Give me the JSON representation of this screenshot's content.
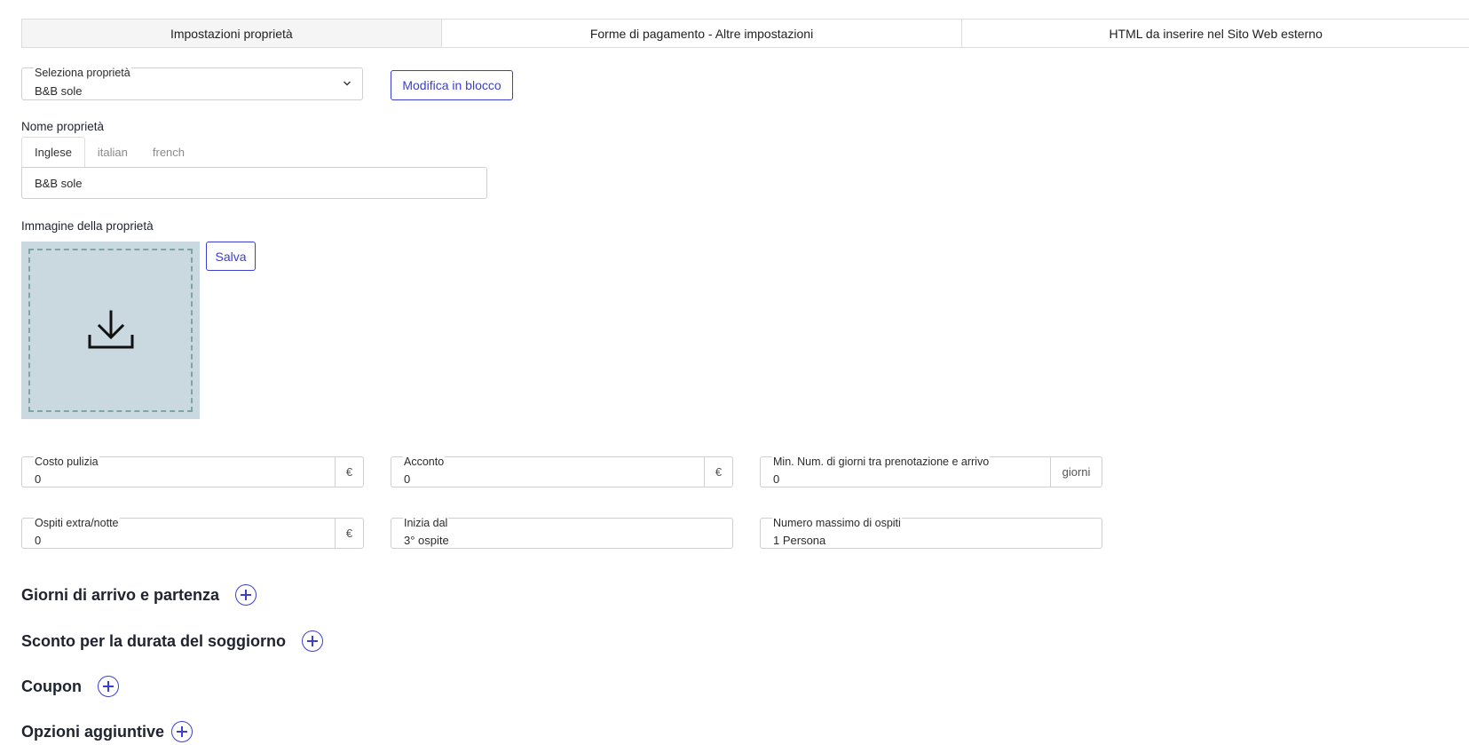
{
  "tabs": [
    {
      "label": "Impostazioni proprietà"
    },
    {
      "label": "Forme di pagamento - Altre impostazioni"
    },
    {
      "label": "HTML da inserire nel Sito Web esterno"
    }
  ],
  "property_select": {
    "label": "Seleziona proprietà",
    "value": "B&B sole"
  },
  "bulk_edit_label": "Modifica in blocco",
  "property_name": {
    "label": "Nome proprietà",
    "languages": [
      "Inglese",
      "italian",
      "french"
    ],
    "value": "B&B sole"
  },
  "property_image": {
    "label": "Immagine della proprietà",
    "save_label": "Salva"
  },
  "fields": {
    "cleaning_cost": {
      "label": "Costo pulizia",
      "value": "0",
      "suffix": "€"
    },
    "deposit": {
      "label": "Acconto",
      "value": "0",
      "suffix": "€"
    },
    "min_days": {
      "label": "Min. Num. di giorni tra prenotazione e arrivo",
      "value": "0",
      "suffix": "giorni"
    },
    "extra_guests": {
      "label": "Ospiti extra/notte",
      "value": "0",
      "suffix": "€"
    },
    "starts_from": {
      "label": "Inizia dal",
      "value": "3° ospite"
    },
    "max_guests": {
      "label": "Numero massimo di ospiti",
      "value": "1 Persona"
    }
  },
  "sections": [
    {
      "title": "Giorni di arrivo e partenza"
    },
    {
      "title": "Sconto per la durata del soggiorno"
    },
    {
      "title": "Coupon"
    },
    {
      "title": "Opzioni aggiuntive"
    }
  ],
  "colors": {
    "accent": "#3b3fd0",
    "upload_bg": "#c9d9df",
    "upload_border": "#7fa4a4"
  }
}
